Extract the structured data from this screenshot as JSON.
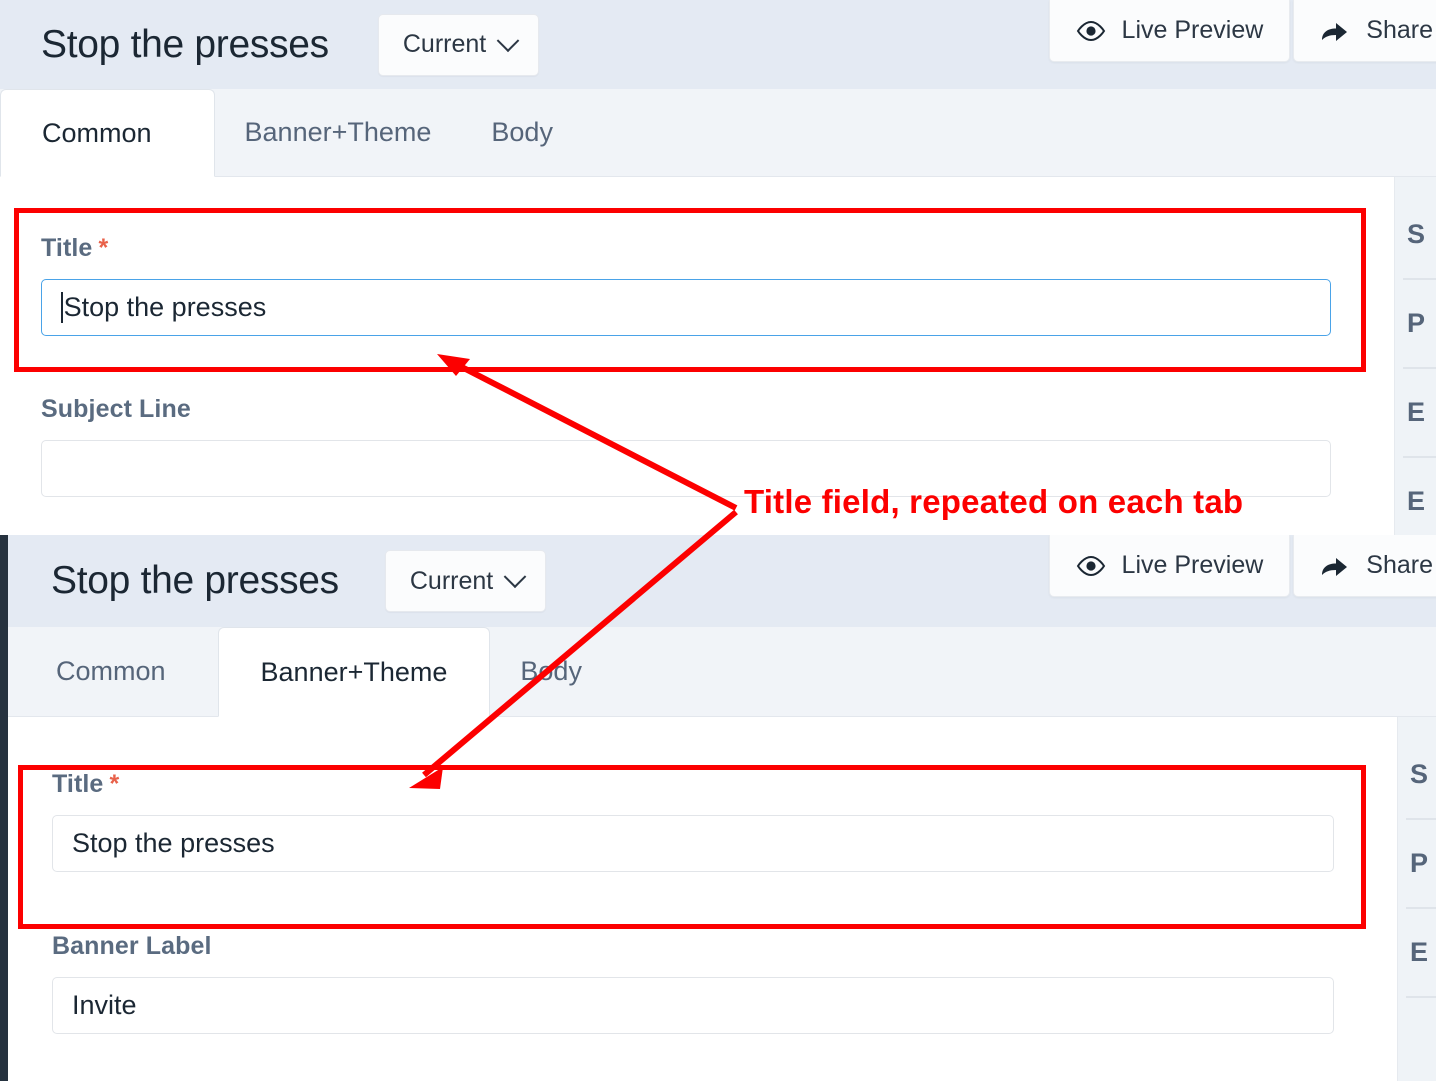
{
  "panels": [
    {
      "id": "common-tab-panel",
      "header": {
        "title": "Stop the presses",
        "version_button": "Current",
        "actions": [
          {
            "label": "Live Preview",
            "icon": "eye-icon"
          },
          {
            "label": "Share",
            "icon": "share-arrow-icon"
          }
        ]
      },
      "tabs": [
        {
          "label": "Common",
          "active": true
        },
        {
          "label": "Banner+Theme",
          "active": false
        },
        {
          "label": "Body",
          "active": false
        }
      ],
      "fields": [
        {
          "label": "Title",
          "required": "*",
          "value": "Stop the presses",
          "placeholder": "",
          "focused": true
        },
        {
          "label": "Subject Line",
          "required": "",
          "value": "",
          "placeholder": "",
          "focused": false
        }
      ],
      "sidebar_items": [
        "S",
        "P",
        "E",
        "E"
      ]
    },
    {
      "id": "banner-theme-tab-panel",
      "header": {
        "title": "Stop the presses",
        "version_button": "Current",
        "actions": [
          {
            "label": "Live Preview",
            "icon": "eye-icon"
          },
          {
            "label": "Share",
            "icon": "share-arrow-icon"
          }
        ]
      },
      "tabs": [
        {
          "label": "Common",
          "active": false
        },
        {
          "label": "Banner+Theme",
          "active": true
        },
        {
          "label": "Body",
          "active": false
        }
      ],
      "fields": [
        {
          "label": "Title",
          "required": "*",
          "value": "Stop the presses",
          "placeholder": "",
          "focused": false
        },
        {
          "label": "Banner Label",
          "required": "",
          "value": "Invite",
          "placeholder": "",
          "focused": false
        }
      ],
      "sidebar_items": [
        "S",
        "P",
        "E"
      ]
    }
  ],
  "annotation": {
    "text": "Title field, repeated on each tab",
    "color": "#fc0000"
  },
  "colors": {
    "header_bg": "#e4eaf3",
    "tabstrip_bg": "#f1f4f8",
    "panel_bg": "#ffffff",
    "label": "#5a6b80",
    "required_asterisk": "#e8614a",
    "focus_border": "#4aa3e8",
    "annotation_red": "#fc0000",
    "left_stripe": "#26323f"
  }
}
